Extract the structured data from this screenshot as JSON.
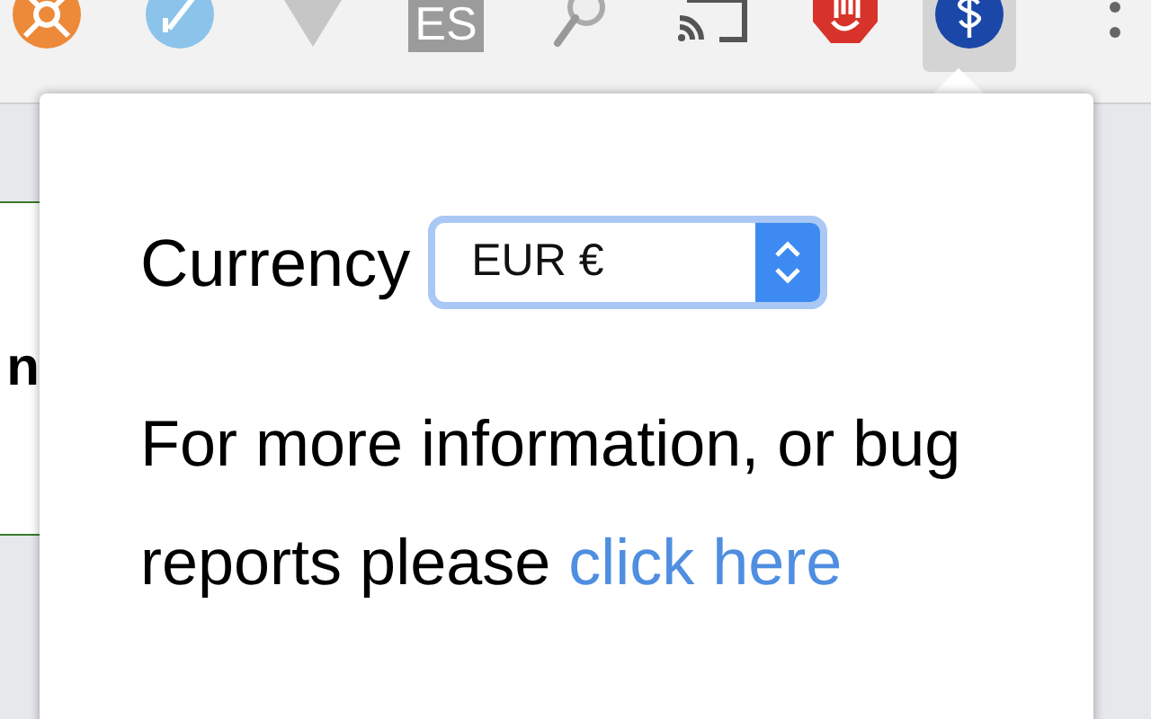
{
  "toolbar": {
    "extensions": [
      {
        "kind": "lifebuoy",
        "selected": false
      },
      {
        "kind": "pen",
        "selected": false
      },
      {
        "kind": "vee",
        "selected": false
      },
      {
        "kind": "badge",
        "label": "ES",
        "selected": false
      },
      {
        "kind": "magnifier",
        "selected": false
      },
      {
        "kind": "cast",
        "selected": false
      },
      {
        "kind": "hand",
        "selected": false
      },
      {
        "kind": "dollar",
        "selected": true
      }
    ]
  },
  "page": {
    "fragment": "n"
  },
  "popup": {
    "label": "Currency",
    "select": {
      "value": "EUR €"
    },
    "info": {
      "text": "For more information, or bug reports please ",
      "link": "click here"
    }
  }
}
